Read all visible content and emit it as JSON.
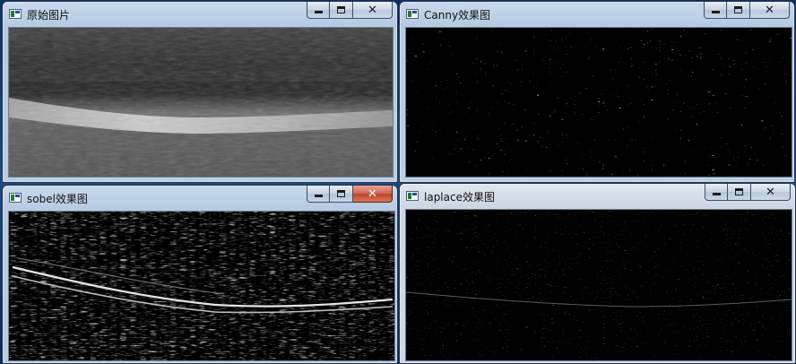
{
  "desktop": {
    "background": "#133a6e"
  },
  "windows": [
    {
      "title": "原始图片",
      "close_glyph": "✕",
      "active": false,
      "view": "original-grayscale"
    },
    {
      "title": "Canny效果图",
      "close_glyph": "✕",
      "active": false,
      "view": "canny-edges"
    },
    {
      "title": "sobel效果图",
      "close_glyph": "✕",
      "active": true,
      "view": "sobel-gradient"
    },
    {
      "title": "laplace效果图",
      "close_glyph": "✕",
      "active": false,
      "view": "laplace-edges"
    }
  ],
  "colors": {
    "titlebar_active": "#b6cbe2",
    "titlebar_inactive": "#ccd7e4",
    "close_hot": "#c0442a",
    "client_bg": "#000000"
  }
}
